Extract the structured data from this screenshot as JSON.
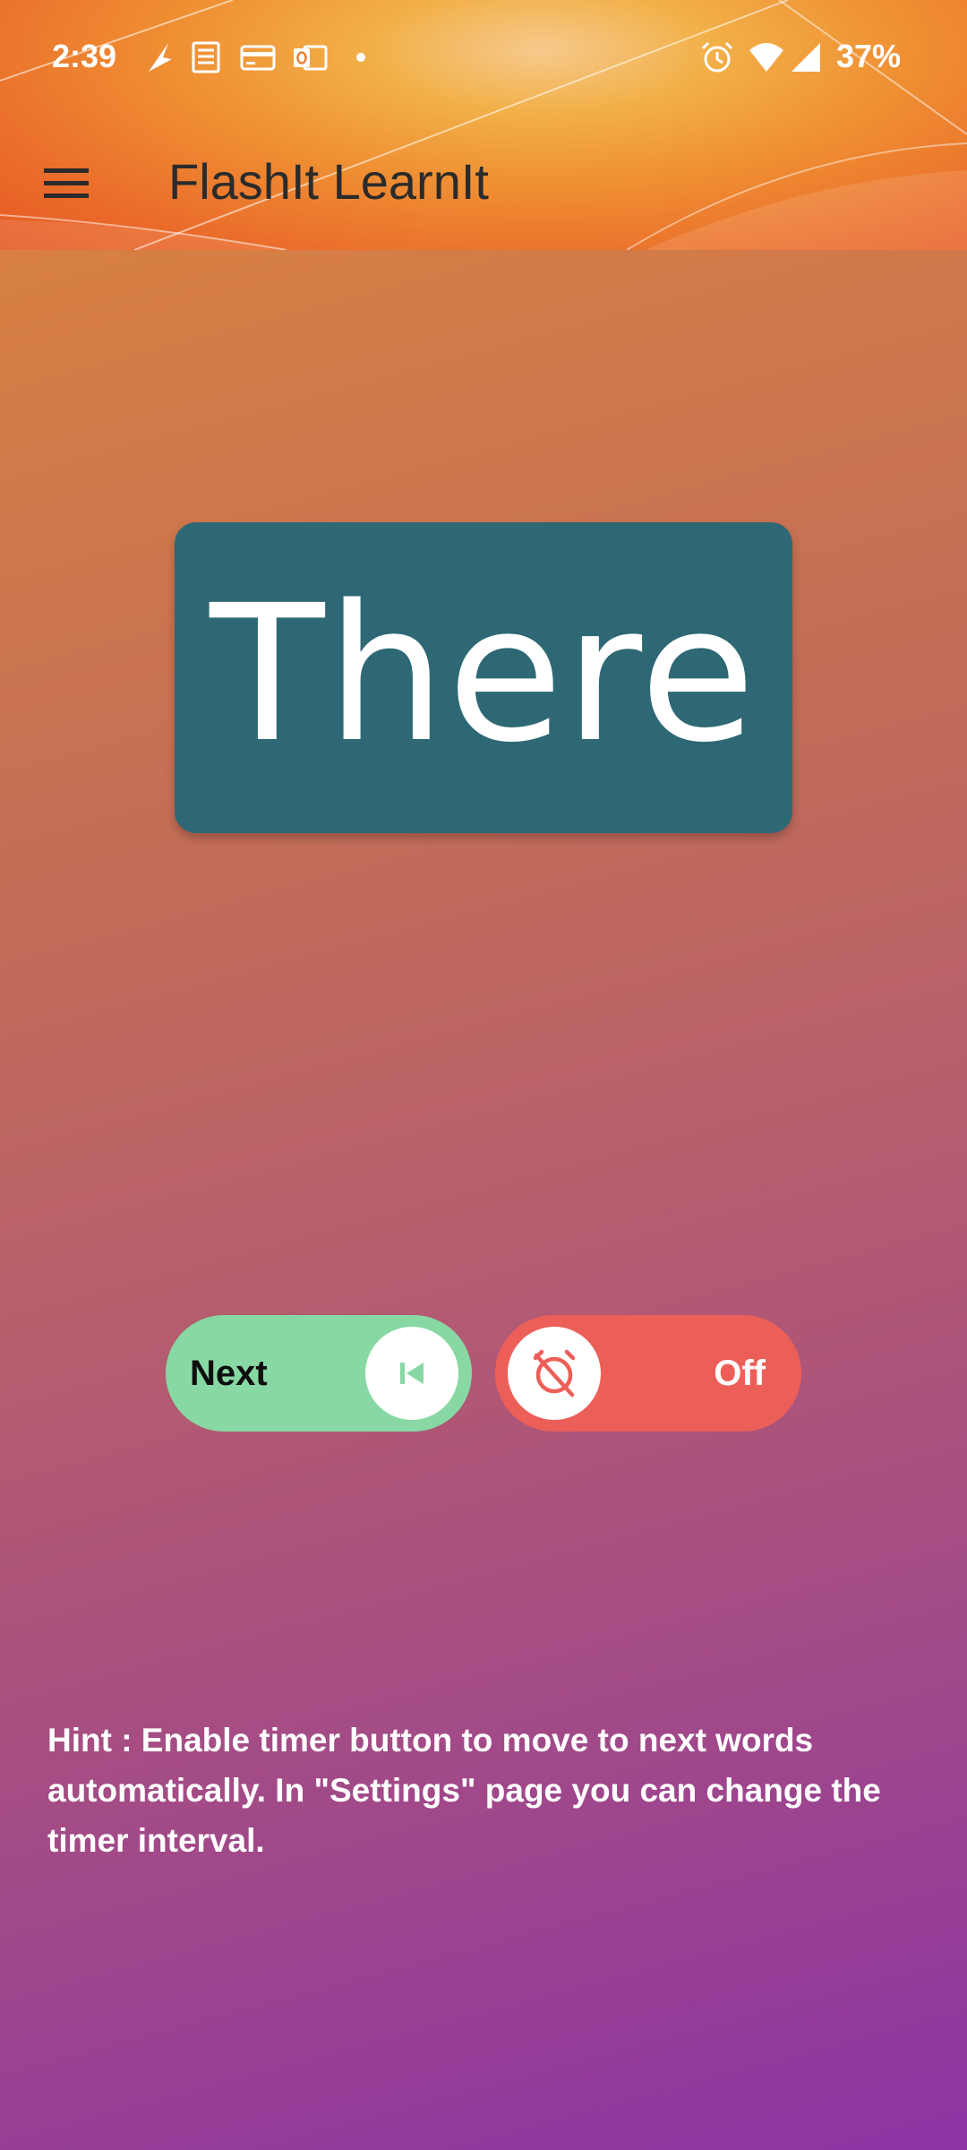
{
  "status_bar": {
    "time": "2:39",
    "battery": "37%",
    "left_icons": [
      "navigation-arrow-icon",
      "document-icon",
      "credit-card-icon",
      "outlook-icon",
      "dot-icon"
    ],
    "right_icons": [
      "alarm-icon",
      "wifi-icon",
      "cell-signal-icon"
    ]
  },
  "app_bar": {
    "title": "FlashIt LearnIt",
    "menu_icon": "hamburger-menu-icon"
  },
  "card": {
    "word": "There",
    "color": "#2e6875"
  },
  "controls": {
    "next": {
      "label": "Next",
      "icon": "skip-previous-icon",
      "color": "#88d8a3"
    },
    "timer": {
      "label": "Off",
      "icon": "timer-off-icon",
      "color": "#ec5f58"
    }
  },
  "hint": {
    "text": "Hint : Enable timer button to move to next words automatically. In \"Settings\" page you can change the timer interval."
  }
}
